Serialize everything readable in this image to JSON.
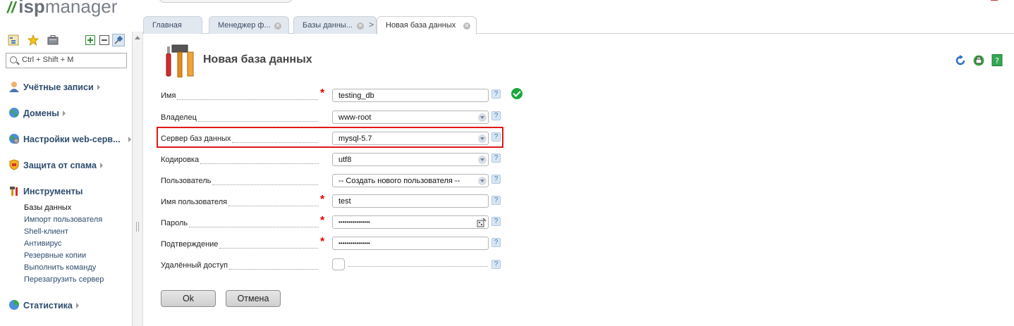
{
  "brand": {
    "isp": "isp",
    "manager": "manager"
  },
  "tabs": [
    {
      "label": "Главная"
    },
    {
      "label": "Менеджер ф..."
    },
    {
      "label": "Базы данны..."
    },
    {
      "label": "Новая база данных"
    }
  ],
  "sidebar": {
    "search_placeholder": "Ctrl + Shift + M",
    "sections": [
      {
        "label": "Учётные записи"
      },
      {
        "label": "Домены"
      },
      {
        "label": "Настройки web-серв..."
      },
      {
        "label": "Защита от спама"
      },
      {
        "label": "Инструменты"
      },
      {
        "label": "Статистика"
      }
    ],
    "tools_items": [
      {
        "label": "Базы данных",
        "active": true
      },
      {
        "label": "Импорт пользователя"
      },
      {
        "label": "Shell-клиент"
      },
      {
        "label": "Антивирус"
      },
      {
        "label": "Резервные копии"
      },
      {
        "label": "Выполнить команду"
      },
      {
        "label": "Перезагрузить сервер"
      }
    ]
  },
  "page": {
    "title": "Новая база данных"
  },
  "form": {
    "fields": [
      {
        "label": "Имя",
        "value": "testing_db",
        "type": "text",
        "required": true
      },
      {
        "label": "Владелец",
        "value": "www-root",
        "type": "select"
      },
      {
        "label": "Сервер баз данных",
        "value": "mysql-5.7",
        "type": "select"
      },
      {
        "label": "Кодировка",
        "value": "utf8",
        "type": "select"
      },
      {
        "label": "Пользователь",
        "value": "-- Создать нового пользователя --",
        "type": "select"
      },
      {
        "label": "Имя пользователя",
        "value": "test",
        "type": "text",
        "required": true
      },
      {
        "label": "Пароль",
        "value": "••••••••••••••••",
        "type": "password",
        "required": true
      },
      {
        "label": "Подтверждение",
        "value": "••••••••••••••••",
        "type": "password",
        "required": true
      },
      {
        "label": "Удалённый доступ",
        "type": "checkbox"
      }
    ],
    "help_label": "?",
    "required_mark": "*",
    "ok_label": "Ok",
    "cancel_label": "Отмена"
  },
  "colors": {
    "accent": "#2e4c6e",
    "highlight": "#e0191a",
    "success": "#1ba83b"
  },
  "icons": [
    "tree-icon",
    "star-icon",
    "briefcase-icon",
    "expand-icon",
    "collapse-icon",
    "pin-icon",
    "refresh-icon",
    "print-icon",
    "help-book-icon",
    "tools-icon"
  ]
}
